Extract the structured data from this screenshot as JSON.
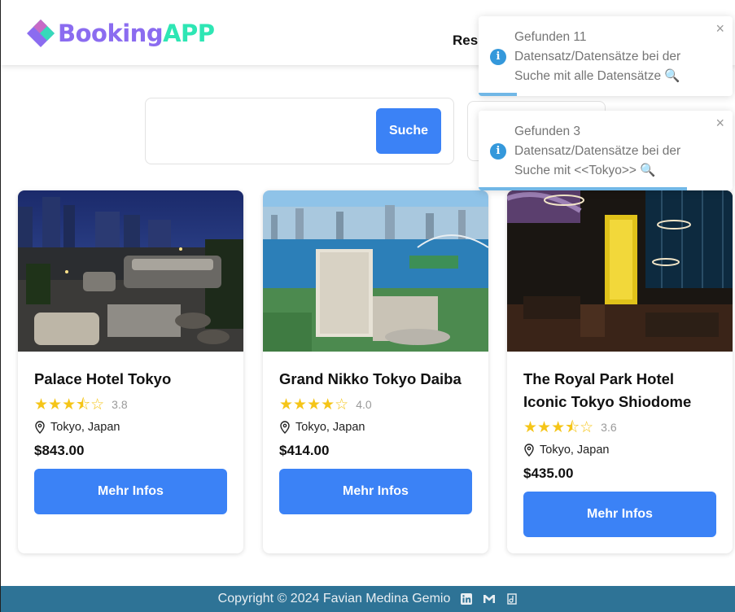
{
  "app": {
    "logo_part1": "Booking",
    "logo_part2": "APP",
    "nav_partial": "Res",
    "colors": {
      "accent": "#3b82f6",
      "logo_purple": "#8b6cf0",
      "logo_green": "#2ee6b4",
      "footer": "#2e7396",
      "toast_info": "#3498db",
      "star": "#f5c518"
    }
  },
  "search": {
    "value": "",
    "placeholder": "",
    "button_label": "Suche"
  },
  "toasts": [
    {
      "icon": "info-icon",
      "message": "Gefunden 11 Datensatz/Datensätze bei der Suche mit alle Datensätze 🔍",
      "close": "×",
      "progress": 0.15
    },
    {
      "icon": "info-icon",
      "message": "Gefunden 3 Datensatz/Datensätze bei der Suche mit <<Tokyo>> 🔍",
      "close": "×",
      "progress": 0.82
    }
  ],
  "hotels": [
    {
      "name": "Palace Hotel Tokyo",
      "rating": 3.8,
      "rating_label": "3.8",
      "location": "Tokyo, Japan",
      "price": "$843.00",
      "button": "Mehr Infos"
    },
    {
      "name": "Grand Nikko Tokyo Daiba",
      "rating": 4.0,
      "rating_label": "4.0",
      "location": "Tokyo, Japan",
      "price": "$414.00",
      "button": "Mehr Infos"
    },
    {
      "name": "The Royal Park Hotel Iconic Tokyo Shiodome",
      "rating": 3.6,
      "rating_label": "3.6",
      "location": "Tokyo, Japan",
      "price": "$435.00",
      "button": "Mehr Infos"
    }
  ],
  "footer": {
    "text": "Copyright © 2024 Favian Medina Gemio",
    "icons": [
      "linkedin-icon",
      "gmail-icon",
      "website-icon"
    ]
  }
}
